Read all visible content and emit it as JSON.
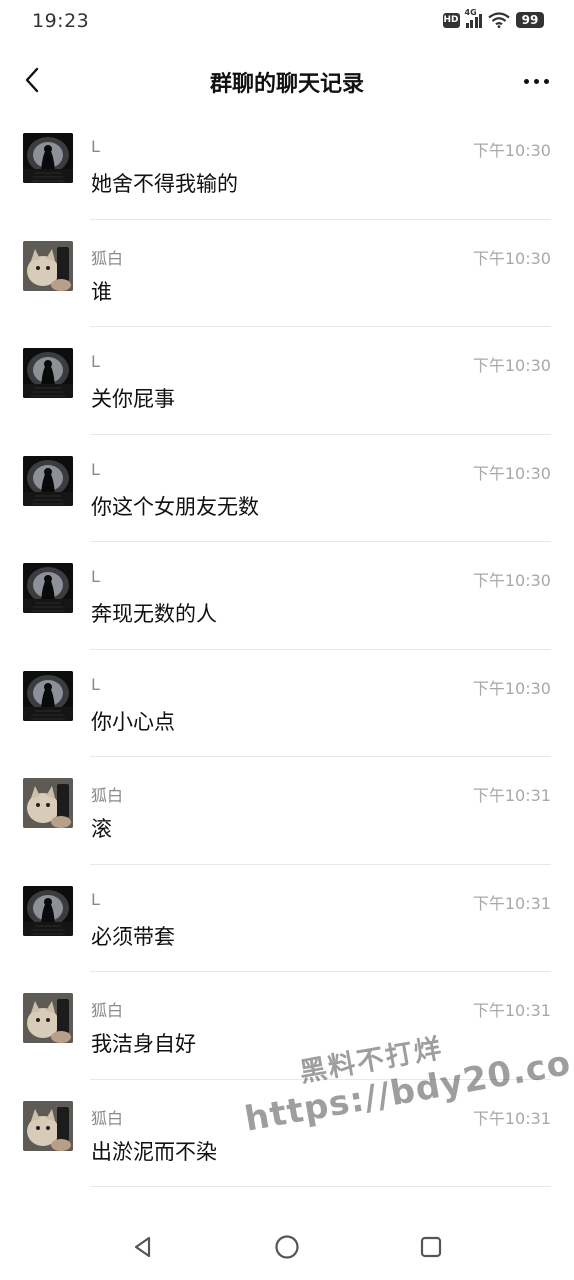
{
  "status_bar": {
    "time": "19:23",
    "hd": "HD",
    "network": "4G",
    "battery": "99"
  },
  "nav": {
    "title": "群聊的聊天记录",
    "back_icon": "chevron-left-icon",
    "more_icon": "more-dots-icon"
  },
  "messages": [
    {
      "sender": "L",
      "time": "下午10:30",
      "text": "她舍不得我输的",
      "avatar": "dark"
    },
    {
      "sender": "狐白",
      "time": "下午10:30",
      "text": "谁",
      "avatar": "cat"
    },
    {
      "sender": "L",
      "time": "下午10:30",
      "text": "关你屁事",
      "avatar": "dark"
    },
    {
      "sender": "L",
      "time": "下午10:30",
      "text": "你这个女朋友无数",
      "avatar": "dark"
    },
    {
      "sender": "L",
      "time": "下午10:30",
      "text": "奔现无数的人",
      "avatar": "dark"
    },
    {
      "sender": "L",
      "time": "下午10:30",
      "text": "你小心点",
      "avatar": "dark"
    },
    {
      "sender": "狐白",
      "time": "下午10:31",
      "text": "滚",
      "avatar": "cat"
    },
    {
      "sender": "L",
      "time": "下午10:31",
      "text": "必须带套",
      "avatar": "dark"
    },
    {
      "sender": "狐白",
      "time": "下午10:31",
      "text": "我洁身自好",
      "avatar": "cat"
    },
    {
      "sender": "狐白",
      "time": "下午10:31",
      "text": "出淤泥而不染",
      "avatar": "cat"
    }
  ],
  "watermark": {
    "line1": "黑料不打烊",
    "line2": "https://bdy20.co"
  },
  "system_nav": {
    "back": "triangle-back-icon",
    "home": "circle-home-icon",
    "recents": "square-recents-icon"
  }
}
